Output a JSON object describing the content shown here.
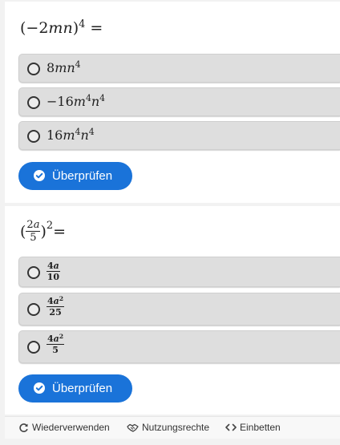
{
  "questions": [
    {
      "prompt": {
        "open": "(−2",
        "vars": "mn",
        "close": ")",
        "exp": "4",
        "eq": " ="
      },
      "options": [
        {
          "coef": "8",
          "v1": "m",
          "v2": "n",
          "e2": "4"
        },
        {
          "coef": "−16",
          "v1": "m",
          "e1": "4",
          "v2": "n",
          "e2": "4"
        },
        {
          "coef": "16",
          "v1": "m",
          "e1": "4",
          "v2": "n",
          "e2": "4"
        }
      ],
      "check_label": "Überprüfen"
    },
    {
      "prompt": {
        "open": "(",
        "num_coef": "2",
        "num_var": "a",
        "den": "5",
        "close": ")",
        "exp": "2",
        "eq": " ="
      },
      "options": [
        {
          "num_coef": "4",
          "num_var": "a",
          "num_exp": "",
          "den": "10"
        },
        {
          "num_coef": "4",
          "num_var": "a",
          "num_exp": "2",
          "den": "25"
        },
        {
          "num_coef": "4",
          "num_var": "a",
          "num_exp": "2",
          "den": "5"
        }
      ],
      "check_label": "Überprüfen"
    }
  ],
  "footer": {
    "reuse": "Wiederverwenden",
    "rights": "Nutzungsrechte",
    "embed": "Einbetten"
  },
  "colors": {
    "button_bg": "#1a73d9",
    "option_bg": "#dedede"
  },
  "icons": {
    "reuse": "refresh-icon",
    "rights": "handshake-icon",
    "embed": "code-icon",
    "check": "check-circle-icon"
  }
}
